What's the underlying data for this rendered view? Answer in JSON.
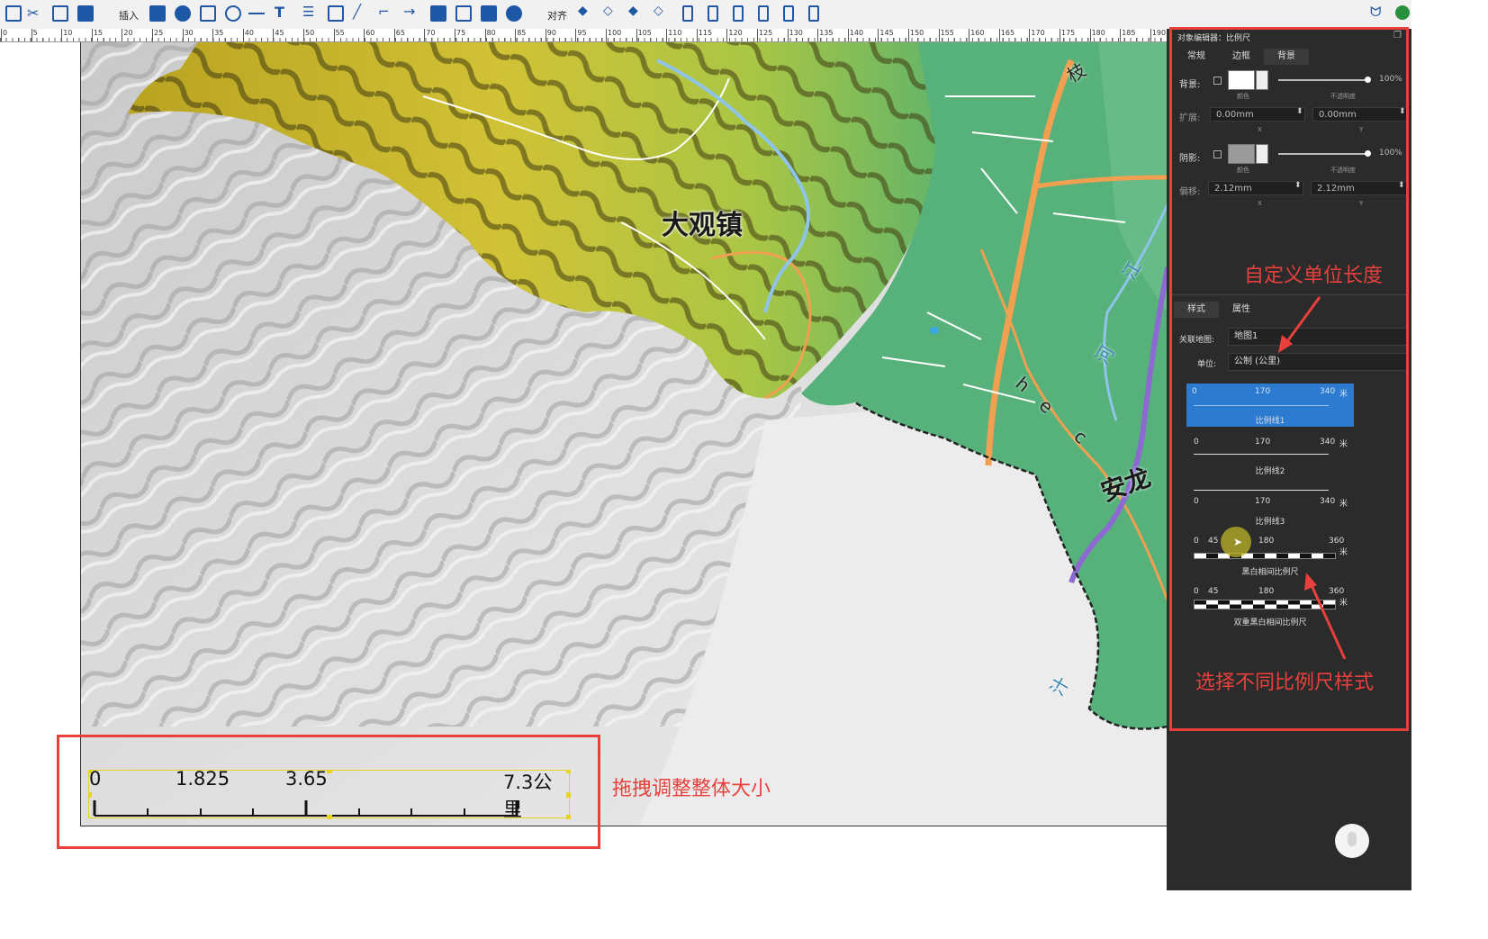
{
  "toolbar": {
    "insert_label": "插入",
    "align_label": "对齐",
    "icons": [
      "menu-icon",
      "cut-icon",
      "copy-icon",
      "delete-icon",
      "map-icon",
      "globe-icon",
      "image-icon",
      "circle-icon",
      "line-icon",
      "text-icon",
      "list-icon",
      "rectangle-icon",
      "pen-icon",
      "polyline-icon",
      "arrow-icon",
      "note-icon",
      "table-icon",
      "picture-icon",
      "web-icon",
      "layer-up-icon",
      "layer-down-icon",
      "layer-top-icon",
      "layer-bottom-icon",
      "align-left-icon",
      "align-center-icon",
      "align-right-icon",
      "align-top-icon",
      "align-middle-icon",
      "align-bottom-icon"
    ]
  },
  "ruler": {
    "labels": [
      "0",
      "5",
      "10",
      "15",
      "20",
      "25",
      "30",
      "35",
      "40",
      "45",
      "50",
      "55",
      "60",
      "65",
      "70",
      "75",
      "80",
      "85",
      "90",
      "95",
      "100",
      "105",
      "110",
      "115",
      "120",
      "125",
      "130",
      "135",
      "140",
      "145",
      "150",
      "155",
      "160",
      "165",
      "170",
      "175",
      "180",
      "185",
      "190"
    ]
  },
  "map": {
    "town_label": "大观镇",
    "river_label_1": "h",
    "river_label_2": "c",
    "river_label_3": "e",
    "town_label_2": "安龙",
    "vertical_text_1": "江",
    "vertical_text_2": "河",
    "vertical_text_3": "汁",
    "road_label": "枝",
    "colors": {
      "mountain_yellow": "#c8b42a",
      "lowland_green": "#4fb07a",
      "hillshade": "#d8d8d8",
      "road_orange": "#f0a050",
      "river_purple": "#8c6ad2"
    }
  },
  "scalebar": {
    "labels": [
      "0",
      "1.825",
      "3.65",
      "7.3公里"
    ]
  },
  "panel": {
    "title": "对象编辑器：比例尺",
    "tabs": [
      "常规",
      "边框",
      "背景"
    ],
    "active_tab": "背景",
    "background_label": "背景:",
    "background_opacity": "100%",
    "color_caption": "颜色",
    "opacity_caption": "不透明度",
    "expand_label": "扩展:",
    "expand_x": "0.00mm",
    "expand_y": "0.00mm",
    "x_caption": "X",
    "y_caption": "Y",
    "shadow_label": "阴影:",
    "shadow_opacity": "100%",
    "offset_label": "偏移:",
    "offset_x": "2.12mm",
    "offset_y": "2.12mm",
    "colors": {
      "background_color": "#ffffff",
      "shadow_color": "#9a9a9a"
    },
    "sub_tabs": [
      "样式",
      "属性"
    ],
    "map_link_label": "关联地图:",
    "map_link_value": "地图1",
    "unit_label": "单位:",
    "unit_value": "公制 (公里)",
    "scale_styles": [
      {
        "name": "比例线1",
        "ticks": [
          "0",
          "170",
          "340",
          "米"
        ]
      },
      {
        "name": "比例线2",
        "ticks": [
          "0",
          "170",
          "340",
          "米"
        ]
      },
      {
        "name": "比例线3",
        "ticks": [
          "0",
          "170",
          "340",
          "米"
        ]
      },
      {
        "name": "黑白相间比例尺",
        "ticks": [
          "0",
          "45",
          "180",
          "360",
          "米"
        ]
      },
      {
        "name": "双重黑白相间比例尺",
        "ticks": [
          "0",
          "45",
          "180",
          "360",
          "米"
        ]
      }
    ]
  },
  "annotations": {
    "custom_unit": "自定义单位长度",
    "choose_style": "选择不同比例尺样式",
    "drag_resize": "拖拽调整整体大小"
  }
}
